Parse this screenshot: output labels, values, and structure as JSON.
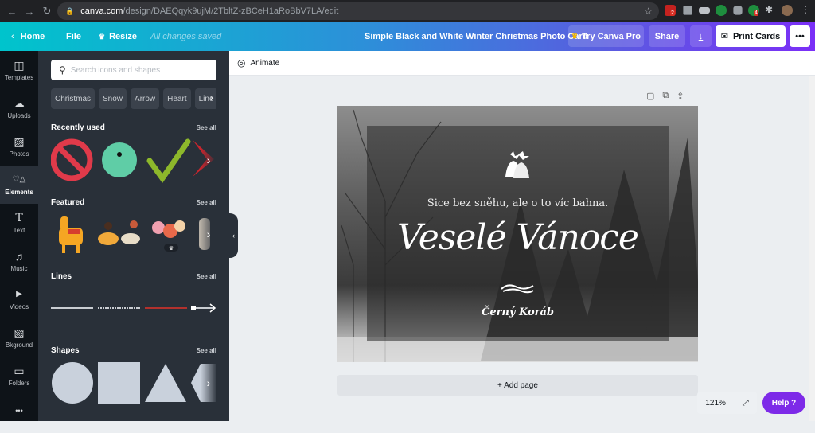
{
  "browser": {
    "url_host": "canva.com",
    "url_path": "/design/DAEQqyk9ujM/2TbltZ-zBCeH1aRoBbV7LA/edit",
    "extension_badges": [
      "2",
      "4"
    ]
  },
  "header": {
    "home_label": "Home",
    "file_label": "File",
    "resize_label": "Resize",
    "save_status": "All changes saved",
    "design_title": "Simple Black and White Winter Christmas Photo Card",
    "try_pro_label": "Try Canva Pro",
    "share_label": "Share",
    "print_label": "Print Cards",
    "more_label": "•••"
  },
  "rail": {
    "items": [
      {
        "label": "Templates",
        "icon": "templates-icon",
        "glyph": "◫"
      },
      {
        "label": "Uploads",
        "icon": "upload-cloud-icon",
        "glyph": "☁"
      },
      {
        "label": "Photos",
        "icon": "photo-icon",
        "glyph": "▨"
      },
      {
        "label": "Elements",
        "icon": "elements-icon",
        "glyph": "♡△",
        "active": true
      },
      {
        "label": "Text",
        "icon": "text-icon",
        "glyph": "T"
      },
      {
        "label": "Music",
        "icon": "music-icon",
        "glyph": "♫"
      },
      {
        "label": "Videos",
        "icon": "video-icon",
        "glyph": "▶"
      },
      {
        "label": "Bkground",
        "icon": "background-icon",
        "glyph": "▧"
      },
      {
        "label": "Folders",
        "icon": "folder-icon",
        "glyph": "▭"
      },
      {
        "label": "More",
        "icon": "more-icon",
        "glyph": "•••"
      }
    ]
  },
  "panel": {
    "search_placeholder": "Search icons and shapes",
    "chips": [
      "Christmas",
      "Snow",
      "Arrow",
      "Heart",
      "Line"
    ],
    "sections": [
      {
        "title": "Recently used",
        "see_all": "See all"
      },
      {
        "title": "Featured",
        "see_all": "See all"
      },
      {
        "title": "Lines",
        "see_all": "See all"
      },
      {
        "title": "Shapes",
        "see_all": "See all"
      }
    ]
  },
  "toolbar": {
    "animate_label": "Animate"
  },
  "card": {
    "subtitle": "Sice bez sněhu, ale o to víc bahna.",
    "title": "Veselé Vánoce",
    "signature": "Černý Koráb"
  },
  "footer": {
    "add_page_label": "+ Add page",
    "zoom_level": "121%",
    "help_label": "Help ?"
  },
  "colors": {
    "accent_purple": "#7d2ae8",
    "panel_bg": "#293039",
    "rail_bg": "#0e1318"
  }
}
